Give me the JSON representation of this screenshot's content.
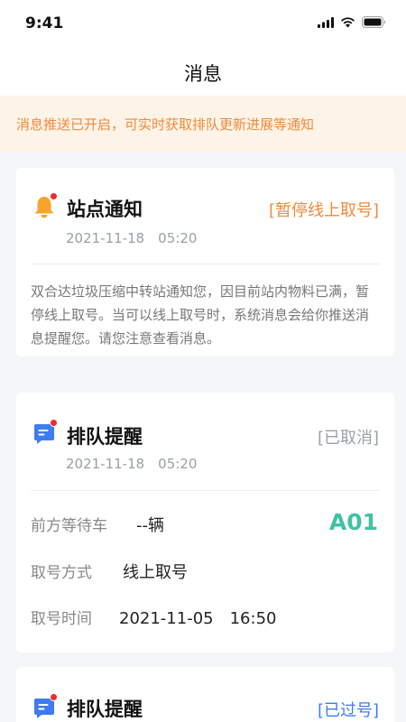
{
  "status_bar": {
    "time": "9:41"
  },
  "nav": {
    "title": "消息"
  },
  "notice": {
    "text": "消息推送已开启，可实时获取排队更新进展等通知"
  },
  "colors": {
    "accent_orange": "#f08a3c",
    "status_gray": "#9aa0a8",
    "queue_green": "#3fc2a5",
    "badge_red": "#ee2b2b"
  },
  "cards": [
    {
      "icon": "bell-icon",
      "title": "站点通知",
      "tag": "[暂停线上取号]",
      "time": "2021-11-18　05:20",
      "body": "双合达垃圾压缩中转站通知您，因目前站内物料已满，暂停线上取号。当可以线上取号时，系统消息会给你推送消息提醒您。请您注意查看消息。"
    },
    {
      "icon": "message-icon",
      "title": "排队提醒",
      "tag": "[已取消]",
      "time": "2021-11-18　05:20",
      "rows": [
        {
          "label": "前方等待车",
          "value": "--辆"
        },
        {
          "label": "取号方式",
          "value": "线上取号"
        },
        {
          "label": "取号时间",
          "value": "2021-11-05　16:50"
        }
      ],
      "queue_number": "A01"
    },
    {
      "icon": "message-icon",
      "title": "排队提醒",
      "tag": "[已过号]"
    }
  ]
}
